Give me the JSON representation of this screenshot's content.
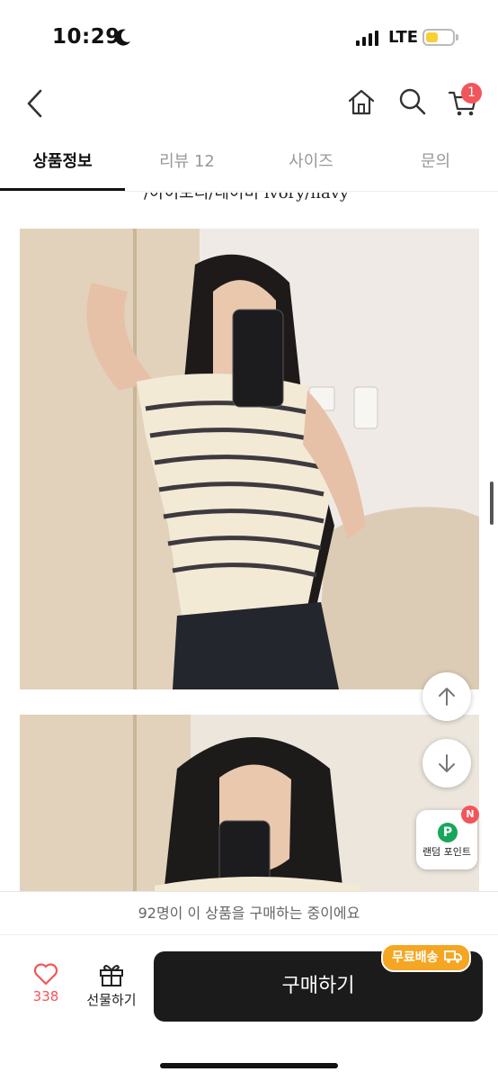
{
  "status_bar": {
    "time": "10:29",
    "network": "LTE"
  },
  "header": {
    "cart_count": "1"
  },
  "tabs": [
    {
      "label": "상품정보"
    },
    {
      "label": "리뷰 12"
    },
    {
      "label": "사이즈"
    },
    {
      "label": "문의"
    }
  ],
  "content": {
    "caption": "/아이보리/네이비 ivory/navy"
  },
  "floating": {
    "point_badge": "N",
    "point_label": "랜덤 포인트",
    "point_icon_letter": "P"
  },
  "notice": "92명이 이 상품을 구매하는 중이에요",
  "bottom_bar": {
    "like_count": "338",
    "gift_label": "선물하기",
    "buy_label": "구매하기",
    "free_shipping": "무료배송"
  },
  "colors": {
    "accent_red": "#f2555a",
    "free_ship": "#f5a623",
    "buy_button": "#1b1b1b"
  }
}
